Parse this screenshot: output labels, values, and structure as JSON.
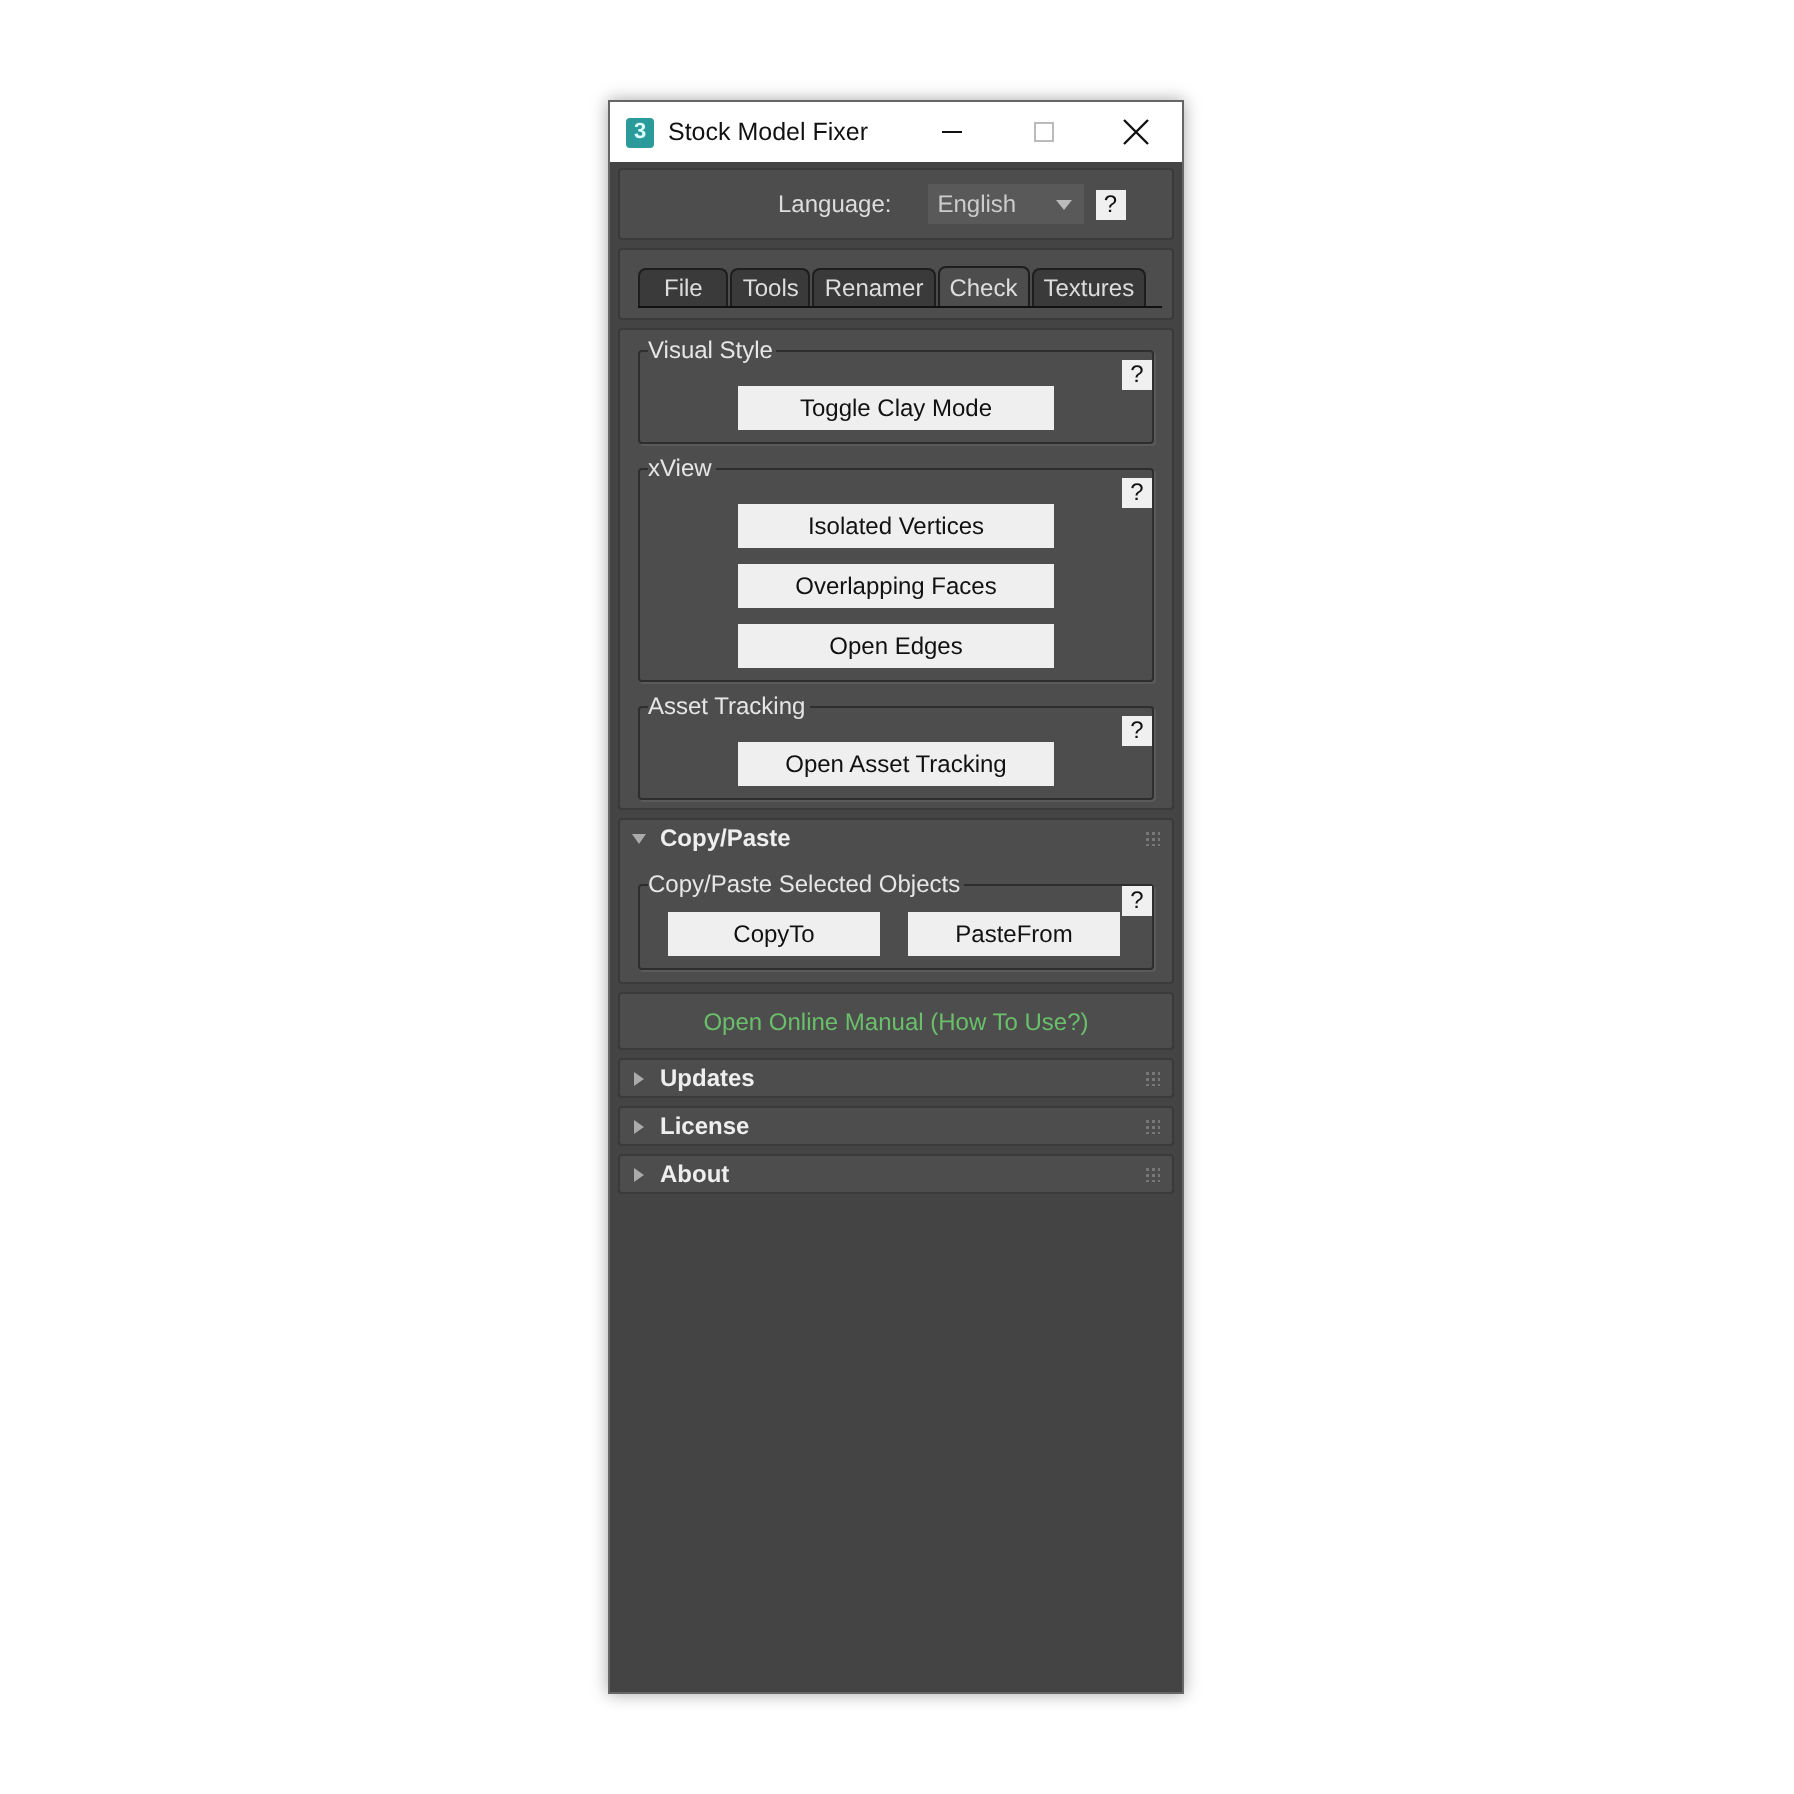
{
  "window": {
    "title": "Stock Model Fixer",
    "icon_label": "3"
  },
  "language": {
    "label": "Language:",
    "value": "English",
    "help": "?"
  },
  "tabs": [
    {
      "label": "File",
      "selected": false
    },
    {
      "label": "Tools",
      "selected": false
    },
    {
      "label": "Renamer",
      "selected": false
    },
    {
      "label": "Check",
      "selected": true
    },
    {
      "label": "Textures",
      "selected": false
    }
  ],
  "check_groups": [
    {
      "title": "Visual Style",
      "help": "?",
      "buttons": [
        "Toggle Clay Mode"
      ]
    },
    {
      "title": "xView",
      "help": "?",
      "buttons": [
        "Isolated Vertices",
        "Overlapping Faces",
        "Open Edges"
      ]
    },
    {
      "title": "Asset Tracking",
      "help": "?",
      "buttons": [
        "Open Asset Tracking"
      ]
    }
  ],
  "sections": [
    {
      "kind": "rollout",
      "title": "Copy/Paste",
      "expanded": true,
      "groups": [
        {
          "title": "Copy/Paste Selected Objects",
          "help": "?",
          "buttons": [
            "CopyTo",
            "PasteFrom"
          ]
        }
      ]
    },
    {
      "kind": "link",
      "text": "Open Online Manual (How To Use?)"
    },
    {
      "kind": "rollout",
      "title": "Updates",
      "expanded": false
    },
    {
      "kind": "rollout",
      "title": "License",
      "expanded": false
    },
    {
      "kind": "rollout",
      "title": "About",
      "expanded": false
    }
  ]
}
